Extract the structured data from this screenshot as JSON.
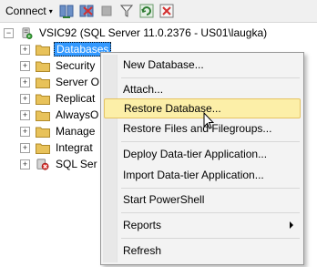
{
  "toolbar": {
    "connect_label": "Connect",
    "caret": "▾"
  },
  "tree": {
    "server": "VSIC92 (SQL Server 11.0.2376 - US01\\laugka)",
    "nodes": [
      {
        "label": "Databases"
      },
      {
        "label": "Security"
      },
      {
        "label": "Server O"
      },
      {
        "label": "Replicat"
      },
      {
        "label": "AlwaysO"
      },
      {
        "label": "Manage"
      },
      {
        "label": "Integrat"
      },
      {
        "label": "SQL Ser"
      }
    ],
    "expander_symbol": "+",
    "collapse_symbol": "−"
  },
  "context_menu": {
    "items": [
      {
        "label": "New Database..."
      },
      {
        "label": "Attach..."
      },
      {
        "label": "Restore Database..."
      },
      {
        "label": "Restore Files and Filegroups..."
      },
      {
        "label": "Deploy Data-tier Application..."
      },
      {
        "label": "Import Data-tier Application..."
      },
      {
        "label": "Start PowerShell"
      },
      {
        "label": "Reports"
      },
      {
        "label": "Refresh"
      }
    ]
  },
  "colors": {
    "selection": "#3399ff",
    "menu_highlight": "#fcefa8",
    "folder": "#e8c25a"
  }
}
